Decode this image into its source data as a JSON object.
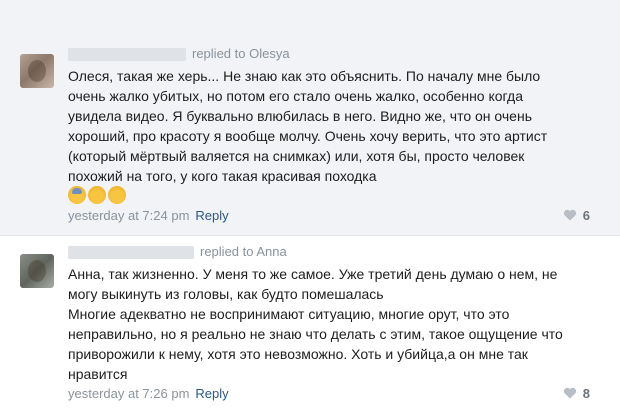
{
  "comments": [
    {
      "reply_to": "replied to Olesya",
      "lines": [
        "Олеся, такая же херь... Не знаю как это объяснить. По началу мне было",
        "очень жалко убитых, но потом его стало очень жалко, особенно когда",
        "увидела видео. Я буквально влюбилась в него. Видно же, что он очень",
        "хороший, про красоту я вообще молчу. Очень хочу верить, что это артист",
        "(который мёртвый валяется на снимках) или, хотя бы, просто человек",
        "похожий на того, у кого такая красивая походка"
      ],
      "emoji": [
        "fearful-face-emoji",
        "sleepy-face-emoji",
        "relieved-face-emoji"
      ],
      "time": "yesterday at 7:24 pm",
      "reply_label": "Reply",
      "likes": "6"
    },
    {
      "reply_to": "replied to Anna",
      "lines": [
        "Анна, так жизненно. У меня то же самое. Уже третий день думаю о нем, не",
        "могу выкинуть из головы, как будто помешалась",
        "Многие адекватно не воспринимают ситуацию, многие орут, что это",
        "неправильно, но я реально не знаю что делать с этим, такое ощущение что",
        "приворожили к нему, хотя это невозможно. Хоть и убийца,а он мне так",
        "нравится"
      ],
      "time": "yesterday at 7:26 pm",
      "reply_label": "Reply",
      "likes": "8"
    }
  ],
  "colors": {
    "highlight_bg": "#f1f3f6",
    "link": "#2a5885",
    "meta": "#8a929b"
  }
}
